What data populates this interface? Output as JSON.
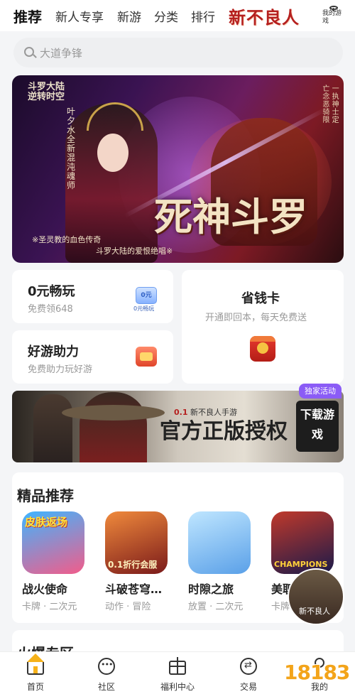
{
  "topnav": {
    "tabs": [
      {
        "label": "推荐",
        "active": true
      },
      {
        "label": "新人专享",
        "active": false
      },
      {
        "label": "新游",
        "active": false
      },
      {
        "label": "分类",
        "active": false
      },
      {
        "label": "排行",
        "active": false
      }
    ],
    "promo_label": "新不良人",
    "my_games_label": "我的游戏"
  },
  "search": {
    "placeholder": "大道争锋"
  },
  "banner": {
    "game_logo": "斗罗大陆 逆转时空",
    "left_note": "叶夕水全新混沌魂师",
    "right_note": "亡 一念 执 恶 神 骑 士 限 定",
    "title": "死神斗罗",
    "subtitle_1": "※圣灵教的血色传奇",
    "subtitle_2": "斗罗大陆的爱恨绝唱※"
  },
  "cards": {
    "free_play": {
      "title": "0元畅玩",
      "sub": "免费领648",
      "badge_top": "0元",
      "badge_bottom": "0元畅玩"
    },
    "save_card": {
      "title": "省钱卡",
      "sub": "开通即回本，每天免费送"
    },
    "helper": {
      "title": "好游助力",
      "sub": "免费助力玩好游"
    }
  },
  "ad": {
    "badge": "独家活动",
    "small": "新不良人手游",
    "small_prefix": "0.1",
    "slogan": "官方正版授权",
    "download": "下载游戏"
  },
  "featured": {
    "heading": "精品推荐",
    "games": [
      {
        "name": "战火使命",
        "tags": "卡牌 · 二次元",
        "icon_text": "皮肤返场",
        "color1": "#3fb5ff",
        "color2": "#f25c8a"
      },
      {
        "name": "斗破苍穹…",
        "tags": "动作 · 冒险",
        "icon_text": "0.1折行会服",
        "color1": "#f08a3c",
        "color2": "#7a1a1a"
      },
      {
        "name": "时隙之旅",
        "tags": "放置 · 二次元",
        "icon_text": "",
        "color1": "#bfe6ff",
        "color2": "#5aa0e8"
      },
      {
        "name": "美职篮",
        "tags": "卡牌 · ",
        "icon_text": "CHAMPIONS",
        "color1": "#c0392b",
        "color2": "#1a1a4a"
      }
    ]
  },
  "section2": {
    "heading": "火爆专区"
  },
  "tabbar": {
    "items": [
      {
        "label": "首页",
        "icon": "home-icon"
      },
      {
        "label": "社区",
        "icon": "chat-icon"
      },
      {
        "label": "福利中心",
        "icon": "gift-icon"
      },
      {
        "label": "交易",
        "icon": "trade-icon"
      },
      {
        "label": "我的",
        "icon": "profile-icon"
      }
    ]
  },
  "watermark": "18183",
  "floater_label": "新不良人"
}
